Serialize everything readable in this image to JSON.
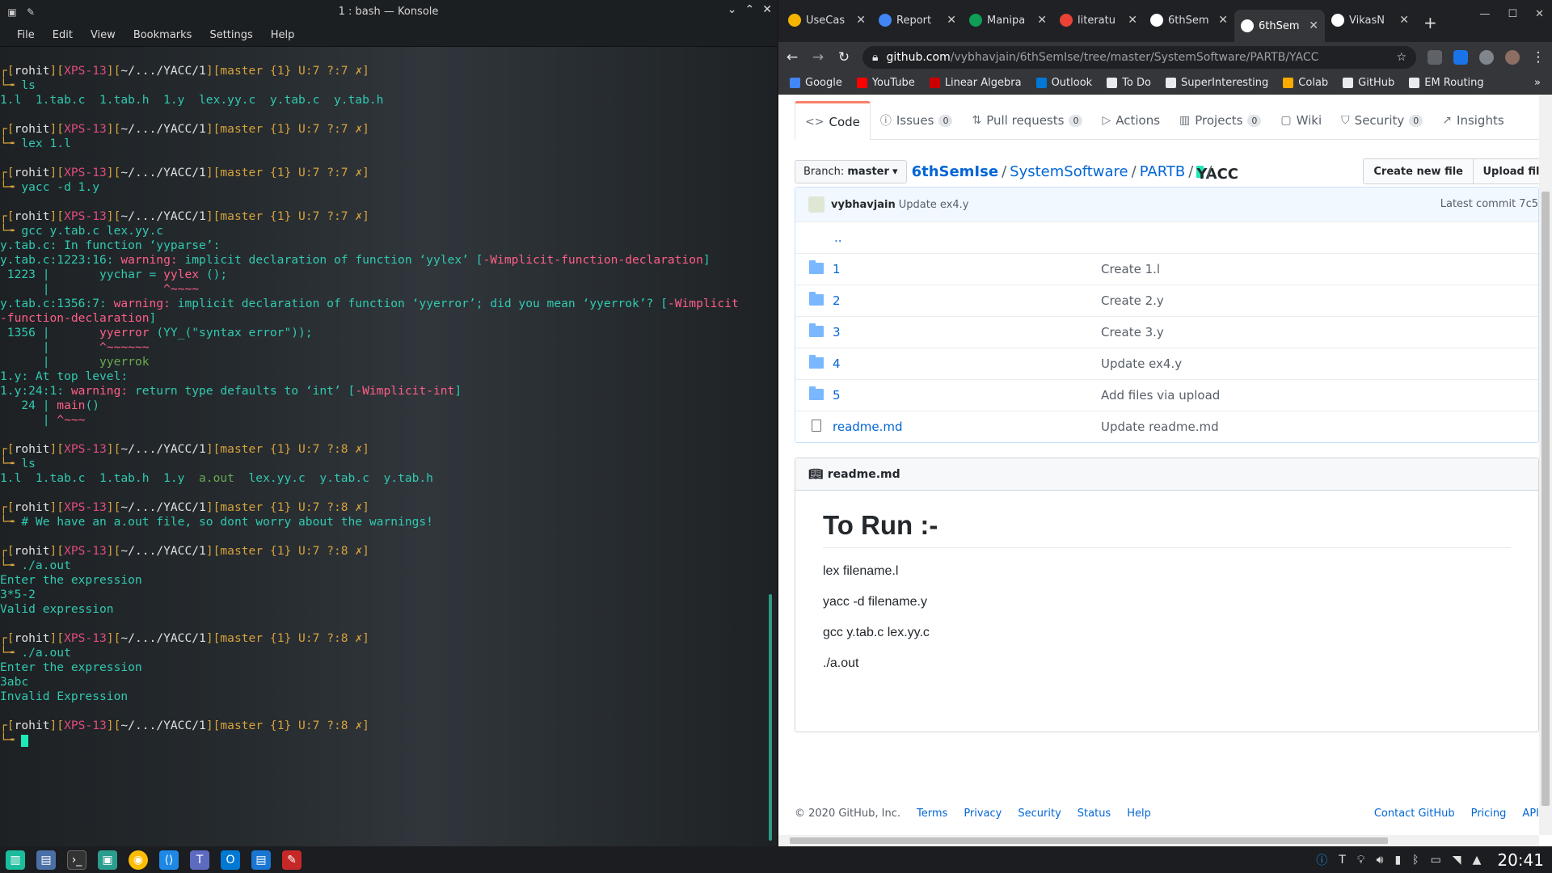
{
  "konsole": {
    "title": "1 : bash — Konsole",
    "menu": [
      "File",
      "Edit",
      "View",
      "Bookmarks",
      "Settings",
      "Help"
    ]
  },
  "terminal": {
    "lines": [
      [
        {
          "t": "┌[",
          "c": "pr"
        },
        {
          "t": "rohit",
          "c": "wh"
        },
        {
          "t": "][",
          "c": "pr"
        },
        {
          "t": "XPS-13",
          "c": "mg"
        },
        {
          "t": "][",
          "c": "pr"
        },
        {
          "t": "~/.../YACC/1",
          "c": "wh"
        },
        {
          "t": "][master {1} U:7 ?:7 ✗]",
          "c": "pr"
        }
      ],
      [
        {
          "t": "└╼ ",
          "c": "pr"
        },
        {
          "t": "ls",
          "c": "cy"
        }
      ],
      [
        {
          "t": "1.l  1.tab.c  1.tab.h  1.y  lex.yy.c  y.tab.c  y.tab.h",
          "c": "cy"
        }
      ],
      [
        {
          "t": "",
          "c": ""
        }
      ],
      [
        {
          "t": "┌[",
          "c": "pr"
        },
        {
          "t": "rohit",
          "c": "wh"
        },
        {
          "t": "][",
          "c": "pr"
        },
        {
          "t": "XPS-13",
          "c": "mg"
        },
        {
          "t": "][",
          "c": "pr"
        },
        {
          "t": "~/.../YACC/1",
          "c": "wh"
        },
        {
          "t": "][master {1} U:7 ?:7 ✗]",
          "c": "pr"
        }
      ],
      [
        {
          "t": "└╼ ",
          "c": "pr"
        },
        {
          "t": "lex 1.l",
          "c": "cy"
        }
      ],
      [
        {
          "t": "",
          "c": ""
        }
      ],
      [
        {
          "t": "┌[",
          "c": "pr"
        },
        {
          "t": "rohit",
          "c": "wh"
        },
        {
          "t": "][",
          "c": "pr"
        },
        {
          "t": "XPS-13",
          "c": "mg"
        },
        {
          "t": "][",
          "c": "pr"
        },
        {
          "t": "~/.../YACC/1",
          "c": "wh"
        },
        {
          "t": "][master {1} U:7 ?:7 ✗]",
          "c": "pr"
        }
      ],
      [
        {
          "t": "└╼ ",
          "c": "pr"
        },
        {
          "t": "yacc -d 1.y",
          "c": "cy"
        }
      ],
      [
        {
          "t": "",
          "c": ""
        }
      ],
      [
        {
          "t": "┌[",
          "c": "pr"
        },
        {
          "t": "rohit",
          "c": "wh"
        },
        {
          "t": "][",
          "c": "pr"
        },
        {
          "t": "XPS-13",
          "c": "mg"
        },
        {
          "t": "][",
          "c": "pr"
        },
        {
          "t": "~/.../YACC/1",
          "c": "wh"
        },
        {
          "t": "][master {1} U:7 ?:7 ✗]",
          "c": "pr"
        }
      ],
      [
        {
          "t": "└╼ ",
          "c": "pr"
        },
        {
          "t": "gcc y.tab.c lex.yy.c",
          "c": "cy"
        }
      ],
      [
        {
          "t": "y.tab.c: In function ‘yyparse’:",
          "c": "cy"
        }
      ],
      [
        {
          "t": "y.tab.c:1223:16: ",
          "c": "cy"
        },
        {
          "t": "warning: ",
          "c": "wr"
        },
        {
          "t": "implicit declaration of function ‘yylex’ [",
          "c": "cy"
        },
        {
          "t": "-Wimplicit-function-declaration",
          "c": "wr"
        },
        {
          "t": "]",
          "c": "cy"
        }
      ],
      [
        {
          "t": " 1223 |       yychar = ",
          "c": "cy"
        },
        {
          "t": "yylex",
          "c": "wr"
        },
        {
          "t": " ();",
          "c": "cy"
        }
      ],
      [
        {
          "t": "      |                ",
          "c": "cy"
        },
        {
          "t": "^~~~~",
          "c": "wr"
        }
      ],
      [
        {
          "t": "y.tab.c:1356:7: ",
          "c": "cy"
        },
        {
          "t": "warning: ",
          "c": "wr"
        },
        {
          "t": "implicit declaration of function ‘yyerror’; did you mean ‘yyerrok’? [",
          "c": "cy"
        },
        {
          "t": "-Wimplicit",
          "c": "wr"
        }
      ],
      [
        {
          "t": "-function-declaration",
          "c": "wr"
        },
        {
          "t": "]",
          "c": "cy"
        }
      ],
      [
        {
          "t": " 1356 |       ",
          "c": "cy"
        },
        {
          "t": "yyerror",
          "c": "wr"
        },
        {
          "t": " (YY_(\"syntax error\"));",
          "c": "cy"
        }
      ],
      [
        {
          "t": "      |       ",
          "c": "cy"
        },
        {
          "t": "^~~~~~~",
          "c": "wr"
        }
      ],
      [
        {
          "t": "      |       ",
          "c": "cy"
        },
        {
          "t": "yyerrok",
          "c": "gr"
        }
      ],
      [
        {
          "t": "1.y: At top level:",
          "c": "cy"
        }
      ],
      [
        {
          "t": "1.y:24:1: ",
          "c": "cy"
        },
        {
          "t": "warning: ",
          "c": "wr"
        },
        {
          "t": "return type defaults to ‘int’ [",
          "c": "cy"
        },
        {
          "t": "-Wimplicit-int",
          "c": "wr"
        },
        {
          "t": "]",
          "c": "cy"
        }
      ],
      [
        {
          "t": "   24 | ",
          "c": "cy"
        },
        {
          "t": "main",
          "c": "wr"
        },
        {
          "t": "()",
          "c": "cy"
        }
      ],
      [
        {
          "t": "      | ",
          "c": "cy"
        },
        {
          "t": "^~~~",
          "c": "wr"
        }
      ],
      [
        {
          "t": "",
          "c": ""
        }
      ],
      [
        {
          "t": "┌[",
          "c": "pr"
        },
        {
          "t": "rohit",
          "c": "wh"
        },
        {
          "t": "][",
          "c": "pr"
        },
        {
          "t": "XPS-13",
          "c": "mg"
        },
        {
          "t": "][",
          "c": "pr"
        },
        {
          "t": "~/.../YACC/1",
          "c": "wh"
        },
        {
          "t": "][master {1} U:7 ?:8 ✗]",
          "c": "pr"
        }
      ],
      [
        {
          "t": "└╼ ",
          "c": "pr"
        },
        {
          "t": "ls",
          "c": "cy"
        }
      ],
      [
        {
          "t": "1.l  1.tab.c  1.tab.h  1.y  ",
          "c": "cy"
        },
        {
          "t": "a.out",
          "c": "gr"
        },
        {
          "t": "  lex.yy.c  y.tab.c  y.tab.h",
          "c": "cy"
        }
      ],
      [
        {
          "t": "",
          "c": ""
        }
      ],
      [
        {
          "t": "┌[",
          "c": "pr"
        },
        {
          "t": "rohit",
          "c": "wh"
        },
        {
          "t": "][",
          "c": "pr"
        },
        {
          "t": "XPS-13",
          "c": "mg"
        },
        {
          "t": "][",
          "c": "pr"
        },
        {
          "t": "~/.../YACC/1",
          "c": "wh"
        },
        {
          "t": "][master {1} U:7 ?:8 ✗]",
          "c": "pr"
        }
      ],
      [
        {
          "t": "└╼ ",
          "c": "pr"
        },
        {
          "t": "# We have an a.out file, so dont worry about the warnings!",
          "c": "cy"
        }
      ],
      [
        {
          "t": "",
          "c": ""
        }
      ],
      [
        {
          "t": "┌[",
          "c": "pr"
        },
        {
          "t": "rohit",
          "c": "wh"
        },
        {
          "t": "][",
          "c": "pr"
        },
        {
          "t": "XPS-13",
          "c": "mg"
        },
        {
          "t": "][",
          "c": "pr"
        },
        {
          "t": "~/.../YACC/1",
          "c": "wh"
        },
        {
          "t": "][master {1} U:7 ?:8 ✗]",
          "c": "pr"
        }
      ],
      [
        {
          "t": "└╼ ",
          "c": "pr"
        },
        {
          "t": "./a.out",
          "c": "cy"
        }
      ],
      [
        {
          "t": "Enter the expression",
          "c": "cy"
        }
      ],
      [
        {
          "t": "3*5-2",
          "c": "cy"
        }
      ],
      [
        {
          "t": "Valid expression",
          "c": "cy"
        }
      ],
      [
        {
          "t": "",
          "c": ""
        }
      ],
      [
        {
          "t": "┌[",
          "c": "pr"
        },
        {
          "t": "rohit",
          "c": "wh"
        },
        {
          "t": "][",
          "c": "pr"
        },
        {
          "t": "XPS-13",
          "c": "mg"
        },
        {
          "t": "][",
          "c": "pr"
        },
        {
          "t": "~/.../YACC/1",
          "c": "wh"
        },
        {
          "t": "][master {1} U:7 ?:8 ✗]",
          "c": "pr"
        }
      ],
      [
        {
          "t": "└╼ ",
          "c": "pr"
        },
        {
          "t": "./a.out",
          "c": "cy"
        }
      ],
      [
        {
          "t": "Enter the expression",
          "c": "cy"
        }
      ],
      [
        {
          "t": "3abc",
          "c": "cy"
        }
      ],
      [
        {
          "t": "Invalid Expression",
          "c": "cy"
        }
      ],
      [
        {
          "t": "",
          "c": ""
        }
      ],
      [
        {
          "t": "┌[",
          "c": "pr"
        },
        {
          "t": "rohit",
          "c": "wh"
        },
        {
          "t": "][",
          "c": "pr"
        },
        {
          "t": "XPS-13",
          "c": "mg"
        },
        {
          "t": "][",
          "c": "pr"
        },
        {
          "t": "~/.../YACC/1",
          "c": "wh"
        },
        {
          "t": "][master {1} U:7 ?:8 ✗]",
          "c": "pr"
        }
      ],
      [
        {
          "t": "└╼ ",
          "c": "pr"
        }
      ]
    ]
  },
  "browser": {
    "tabs": [
      {
        "label": "UseCas",
        "color": "#f4b400"
      },
      {
        "label": "Report",
        "color": "#4285f4"
      },
      {
        "label": "Manipa",
        "color": "#0f9d58"
      },
      {
        "label": "literatu",
        "color": "#ea4335"
      },
      {
        "label": "6thSem",
        "color": "#ffffff"
      },
      {
        "label": "6thSem",
        "color": "#ffffff",
        "active": true
      },
      {
        "label": "VikasN",
        "color": "#ffffff"
      }
    ],
    "new_tab": "+",
    "url_domain": "github.com",
    "url_rest": "/vybhavjain/6thSemIse/tree/master/SystemSoftware/PARTB/YACC",
    "bookmarks": [
      {
        "label": "Google",
        "color": "#4285f4"
      },
      {
        "label": "YouTube",
        "color": "#ff0000"
      },
      {
        "label": "Linear Algebra",
        "color": "#cc0000"
      },
      {
        "label": "Outlook",
        "color": "#0078d4"
      },
      {
        "label": "To Do",
        "color": "#e8eaed"
      },
      {
        "label": "SuperInteresting",
        "color": "#e8eaed"
      },
      {
        "label": "Colab",
        "color": "#f9ab00"
      },
      {
        "label": "GitHub",
        "color": "#e8eaed"
      },
      {
        "label": "EM Routing",
        "color": "#e8eaed"
      }
    ]
  },
  "github": {
    "tabs": [
      {
        "label": "Code",
        "icon": "<>",
        "selected": true
      },
      {
        "label": "Issues",
        "icon": "ⓘ",
        "count": "0"
      },
      {
        "label": "Pull requests",
        "icon": "⇅",
        "count": "0"
      },
      {
        "label": "Actions",
        "icon": "▷"
      },
      {
        "label": "Projects",
        "icon": "▥",
        "count": "0"
      },
      {
        "label": "Wiki",
        "icon": "▢"
      },
      {
        "label": "Security",
        "icon": "⛉",
        "count": "0"
      },
      {
        "label": "Insights",
        "icon": "↗"
      }
    ],
    "branch_prefix": "Branch:",
    "branch": "master",
    "crumbs": [
      "6thSemIse",
      "SystemSoftware",
      "PARTB",
      "YACC"
    ],
    "create_file": "Create new file",
    "upload_files": "Upload files",
    "commit_user": "vybhavjain",
    "commit_msg": "Update ex4.y",
    "latest_commit": "Latest commit 7c5",
    "parent_dir": "..",
    "files": [
      {
        "name": "1",
        "type": "dir",
        "msg": "Create 1.l"
      },
      {
        "name": "2",
        "type": "dir",
        "msg": "Create 2.y"
      },
      {
        "name": "3",
        "type": "dir",
        "msg": "Create 3.y"
      },
      {
        "name": "4",
        "type": "dir",
        "msg": "Update ex4.y"
      },
      {
        "name": "5",
        "type": "dir",
        "msg": "Add files via upload"
      },
      {
        "name": "readme.md",
        "type": "file",
        "msg": "Update readme.md"
      }
    ],
    "readme_title": "readme.md",
    "readme_h1": "To Run :-",
    "readme_lines": [
      "lex filename.l",
      "yacc -d filename.y",
      "gcc y.tab.c lex.yy.c",
      "./a.out"
    ],
    "footer": {
      "copyright": "© 2020 GitHub, Inc.",
      "left_links": [
        "Terms",
        "Privacy",
        "Security",
        "Status",
        "Help"
      ],
      "right_links": [
        "Contact GitHub",
        "Pricing",
        "API"
      ]
    }
  },
  "taskbar": {
    "clock": "20:41"
  }
}
